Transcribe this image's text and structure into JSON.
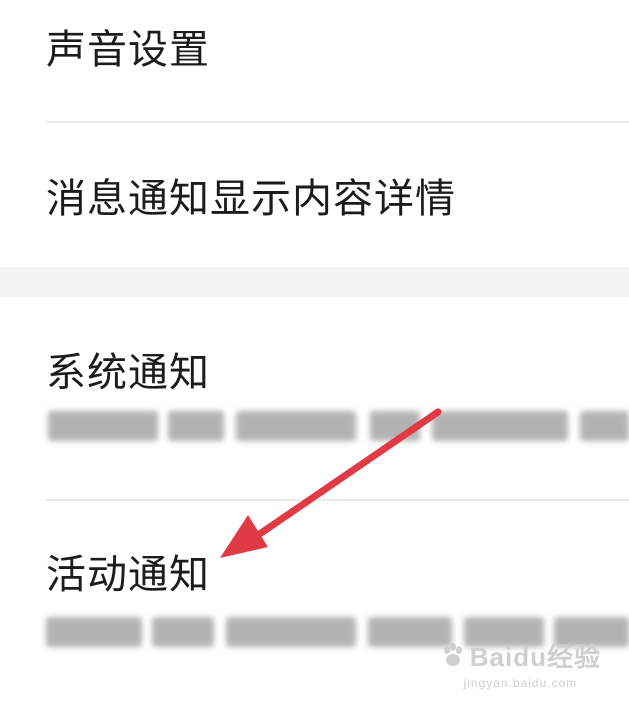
{
  "settings": {
    "sound_settings": "声音设置",
    "notification_detail": "消息通知显示内容详情",
    "system_notification": "系统通知",
    "activity_notification": "活动通知"
  },
  "watermark": {
    "logo_text": "Baidu经验",
    "url": "jingyan.baidu.com"
  },
  "colors": {
    "arrow": "#e03a45",
    "divider": "#ececec",
    "section_gap": "#f3f3f3",
    "text": "#1c1c1c"
  },
  "icons": [
    "annotation-arrow-icon",
    "baidu-paw-icon"
  ]
}
